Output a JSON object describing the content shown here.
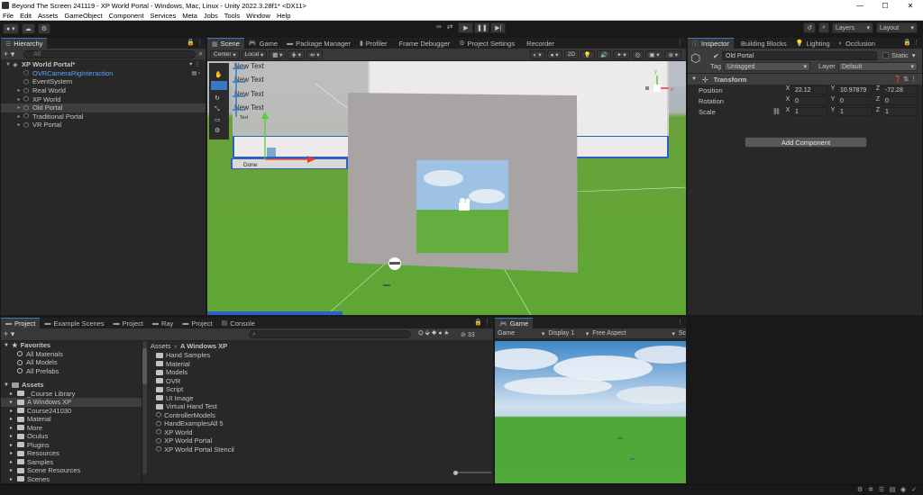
{
  "window": {
    "title": "Beyond The Screen 241119 - XP World Portal - Windows, Mac, Linux - Unity 2022.3.28f1* <DX11>"
  },
  "menu": [
    "File",
    "Edit",
    "Assets",
    "GameObject",
    "Component",
    "Services",
    "Meta",
    "Jobs",
    "Tools",
    "Window",
    "Help"
  ],
  "toolbar": {
    "layers_label": "Layers",
    "layout_label": "Layout"
  },
  "hierarchy": {
    "tab_label": "Hierarchy",
    "search_placeholder": "All",
    "items": [
      {
        "label": "XP World Portal*",
        "depth": 0,
        "expanded": true,
        "scene": true
      },
      {
        "label": "OVRCameraRigInteraction",
        "depth": 1,
        "blue": true
      },
      {
        "label": "EventSystem",
        "depth": 1
      },
      {
        "label": "Real World",
        "depth": 1
      },
      {
        "label": "XP World",
        "depth": 1
      },
      {
        "label": "Old Portal",
        "depth": 1,
        "selected": true
      },
      {
        "label": "Traditional Portal",
        "depth": 1
      },
      {
        "label": "VR Portal",
        "depth": 1
      }
    ]
  },
  "scene_tabs": [
    {
      "label": "Scene",
      "active": true
    },
    {
      "label": "Game"
    },
    {
      "label": "Package Manager"
    },
    {
      "label": "Profiler"
    },
    {
      "label": "Frame Debugger"
    },
    {
      "label": "Project Settings"
    },
    {
      "label": "Recorder"
    }
  ],
  "scene_toolbar": {
    "pivot": "Center",
    "space": "Local",
    "mode_2d": "2D"
  },
  "scene": {
    "text_labels": [
      "New Text",
      "New Text",
      "New Text",
      "New Text"
    ],
    "small_label": "Text",
    "taskbar_label": "Done",
    "gizmo_axes": {
      "y": "y",
      "x": "x"
    }
  },
  "inspector_tabs": [
    {
      "label": "Inspector",
      "active": true
    },
    {
      "label": "Building Blocks"
    },
    {
      "label": "Lighting"
    },
    {
      "label": "Occlusion"
    }
  ],
  "inspector": {
    "object_name": "Old Portal",
    "static_label": "Static",
    "tag_label": "Tag",
    "tag_value": "Untagged",
    "layer_label": "Layer",
    "layer_value": "Default",
    "component": "Transform",
    "position_label": "Position",
    "position": {
      "x": "22.12",
      "y": "10.97879",
      "z": "-72.28"
    },
    "rotation_label": "Rotation",
    "rotation": {
      "x": "0",
      "y": "0",
      "z": "0"
    },
    "scale_label": "Scale",
    "scale": {
      "x": "1",
      "y": "1",
      "z": "1"
    },
    "add_component": "Add Component"
  },
  "project_tabs": [
    {
      "label": "Project",
      "active": true
    },
    {
      "label": "Example Scenes"
    },
    {
      "label": "Project"
    },
    {
      "label": "Ray"
    },
    {
      "label": "Project"
    },
    {
      "label": "Console"
    }
  ],
  "project": {
    "search_count": "33",
    "favorites_label": "Favorites",
    "favorites": [
      "All Materials",
      "All Models",
      "All Prefabs"
    ],
    "assets_label": "Assets",
    "asset_folders": [
      {
        "label": "_Course Library"
      },
      {
        "label": "A Windows XP",
        "selected": true
      },
      {
        "label": "Course241030"
      },
      {
        "label": "Material"
      },
      {
        "label": "More"
      },
      {
        "label": "Oculus"
      },
      {
        "label": "Plugins"
      },
      {
        "label": "Resources"
      },
      {
        "label": "Samples"
      },
      {
        "label": "Scene Resources"
      },
      {
        "label": "Scenes"
      }
    ],
    "breadcrumb_root": "Assets",
    "breadcrumb_current": "A Windows XP",
    "files": [
      {
        "label": "Hand Samples",
        "kind": "folder"
      },
      {
        "label": "Material",
        "kind": "folder"
      },
      {
        "label": "Models",
        "kind": "folder"
      },
      {
        "label": "OVR",
        "kind": "folder"
      },
      {
        "label": "Script",
        "kind": "folder"
      },
      {
        "label": "UI Image",
        "kind": "folder"
      },
      {
        "label": "Virtual Hand Test",
        "kind": "folder"
      },
      {
        "label": "ControllerModels",
        "kind": "unity"
      },
      {
        "label": "HandExamplesAll 5",
        "kind": "unity"
      },
      {
        "label": "XP World",
        "kind": "unity"
      },
      {
        "label": "XP World Portal",
        "kind": "unity"
      },
      {
        "label": "XP World Portal Stencil",
        "kind": "unity"
      }
    ]
  },
  "game_panel": {
    "tab_label": "Game",
    "mode": "Game",
    "display": "Display 1",
    "aspect": "Free Aspect",
    "scale_prefix": "Sc"
  },
  "colors": {
    "accent": "#3a79bb",
    "hierarchy_blue": "#55a6ff",
    "sky": "#b6bcc4",
    "grass": "#5ea734",
    "portal_frame": "#a8a3a3"
  }
}
